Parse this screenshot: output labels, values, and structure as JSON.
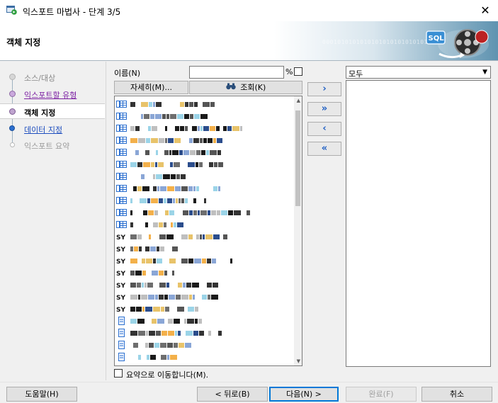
{
  "window": {
    "title": "익스포트 마법사 - 단계 3/5",
    "close_glyph": "✕",
    "app_icon": "export-wizard-icon"
  },
  "banner": {
    "heading": "객체 지정",
    "binary_text": "0001010101010101010101010101",
    "graphic_label": "SQL",
    "graphic_icon": "database-film-reel-icon"
  },
  "steps": [
    {
      "label": "소스/대상",
      "state": "done"
    },
    {
      "label": "익스포트할 유형",
      "state": "link"
    },
    {
      "label": "객체 지정",
      "state": "current"
    },
    {
      "label": "데이터 지정",
      "state": "next"
    },
    {
      "label": "익스포트 요약",
      "state": "future"
    }
  ],
  "filter": {
    "name_label": "이름(N)",
    "name_value": "",
    "percent_sign": "%",
    "detail_button": "자세히(M)...",
    "search_button": "조회(K)",
    "search_icon": "binoculars-icon"
  },
  "available_list": {
    "item_types": [
      "table",
      "table",
      "table",
      "table",
      "table",
      "table",
      "table",
      "table",
      "table",
      "table",
      "table",
      "synonym",
      "synonym",
      "synonym",
      "synonym",
      "synonym",
      "synonym",
      "synonym",
      "procedure",
      "procedure",
      "procedure",
      "procedure"
    ],
    "redacted": true
  },
  "shuttle": {
    "move_one": "›",
    "move_all": "»",
    "remove_one": "‹",
    "remove_all": "«"
  },
  "selected": {
    "filter_value": "모두",
    "dropdown_glyph": "▼"
  },
  "summary_checkbox": {
    "label": "요약으로 이동합니다(M).",
    "checked": false
  },
  "footer": {
    "help": "도움말(H)",
    "back": "< 뒤로(B)",
    "next": "다음(N) >",
    "finish": "완료(F)",
    "cancel": "취소"
  }
}
